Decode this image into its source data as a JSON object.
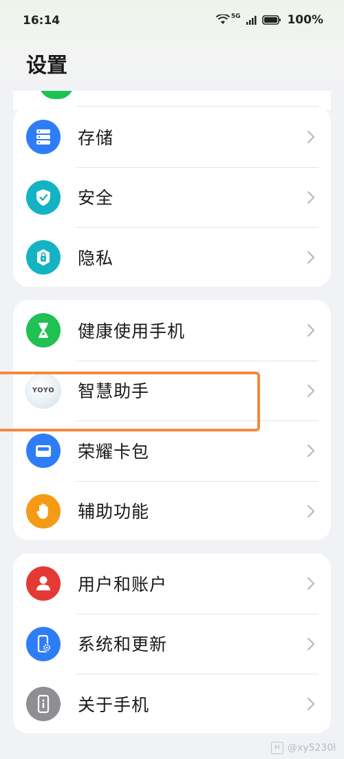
{
  "status_bar": {
    "time": "16:14",
    "network": "5G",
    "battery": "100%"
  },
  "header": {
    "title": "设置"
  },
  "groups": [
    {
      "items": [
        {
          "label": "存储",
          "icon": "storage-icon",
          "color": "#2f7df6"
        },
        {
          "label": "安全",
          "icon": "shield-check-icon",
          "color": "#13b3c4"
        },
        {
          "label": "隐私",
          "icon": "privacy-lock-icon",
          "color": "#13b3c4"
        }
      ]
    },
    {
      "items": [
        {
          "label": "健康使用手机",
          "icon": "hourglass-icon",
          "color": "#1fc153"
        },
        {
          "label": "智慧助手",
          "icon": "yoyo-logo-icon",
          "color": "#e8eef2",
          "logo_text": "YOYO"
        },
        {
          "label": "荣耀卡包",
          "icon": "wallet-icon",
          "color": "#2f7df6"
        },
        {
          "label": "辅助功能",
          "icon": "hand-icon",
          "color": "#f59a14"
        }
      ]
    },
    {
      "items": [
        {
          "label": "用户和账户",
          "icon": "user-icon",
          "color": "#e53935"
        },
        {
          "label": "系统和更新",
          "icon": "phone-settings-icon",
          "color": "#2f7df6"
        },
        {
          "label": "关于手机",
          "icon": "phone-info-icon",
          "color": "#8e8e93"
        }
      ]
    }
  ],
  "watermark": "@xy5230l",
  "colors": {
    "highlight": "#f4883d",
    "background": "#f1f2f6"
  }
}
